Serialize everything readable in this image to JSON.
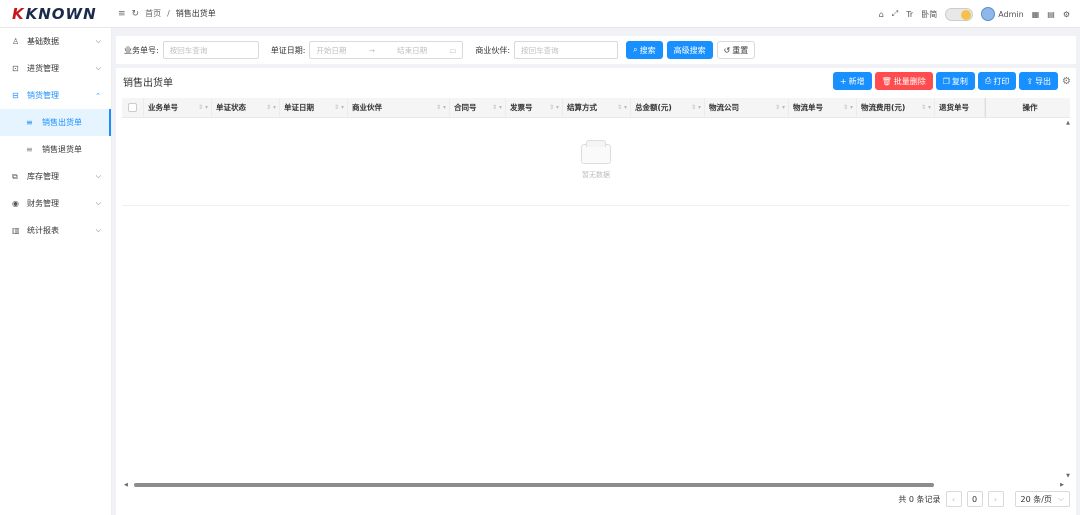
{
  "header": {
    "logo_text": "KNOWN",
    "home": "首页",
    "separator": "/",
    "current": "销售出货单",
    "font_label": "Tr",
    "lang_label": "卧简",
    "user": "Admin"
  },
  "sidebar": {
    "items": [
      {
        "label": "基础数据",
        "icon": "user-icon"
      },
      {
        "label": "进货管理",
        "icon": "inbound-icon"
      },
      {
        "label": "销货管理",
        "icon": "sales-icon"
      },
      {
        "label": "库存管理",
        "icon": "inventory-icon"
      },
      {
        "label": "财务管理",
        "icon": "finance-icon"
      },
      {
        "label": "统计报表",
        "icon": "chart-icon"
      }
    ],
    "sub_items": [
      {
        "label": "销售出货单"
      },
      {
        "label": "销售退货单"
      }
    ]
  },
  "search": {
    "order_no_label": "业务单号:",
    "order_no_placeholder": "按回车查询",
    "date_label": "单证日期:",
    "start_placeholder": "开始日期",
    "range_sep": "→",
    "end_placeholder": "结束日期",
    "partner_label": "商业伙伴:",
    "partner_placeholder": "按回车查询",
    "search_btn": "搜索",
    "advanced_btn": "高级搜索",
    "reset_btn": "重置"
  },
  "card": {
    "title": "销售出货单",
    "actions": {
      "add": "新增",
      "batch_delete": "批量删除",
      "copy": "复制",
      "print": "打印",
      "export": "导出"
    }
  },
  "table": {
    "columns": [
      "业务单号",
      "单证状态",
      "单证日期",
      "商业伙伴",
      "合同号",
      "发票号",
      "结算方式",
      "总金额(元)",
      "物流公司",
      "物流单号",
      "物流费用(元)",
      "退货单号",
      "操作"
    ],
    "empty_text": "暂无数据"
  },
  "pagination": {
    "total_text": "共 0 条记录",
    "current_page": "0",
    "page_size": "20 条/页"
  }
}
